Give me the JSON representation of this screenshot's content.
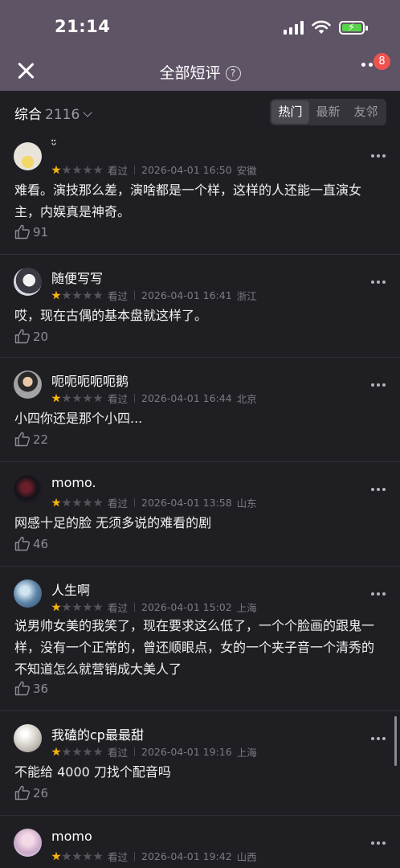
{
  "status_bar": {
    "time": "21:14"
  },
  "header": {
    "title": "全部短评",
    "help_icon": "?",
    "badge_count": "8"
  },
  "filter": {
    "sort_label": "综合",
    "count": "2116",
    "tabs": [
      {
        "label": "热门",
        "active": true
      },
      {
        "label": "最新",
        "active": false
      },
      {
        "label": "友邻",
        "active": false
      }
    ]
  },
  "reviews": [
    {
      "name": "ᵕ̈",
      "rating": 1,
      "status": "看过",
      "datetime": "2026-04-01 16:50",
      "location": "安徽",
      "text": "难看。演技那么差，演啥都是一个样，这样的人还能一直演女主，内娱真是神奇。",
      "likes": "91"
    },
    {
      "name": "随便写写",
      "rating": 1,
      "status": "看过",
      "datetime": "2026-04-01 16:41",
      "location": "浙江",
      "text": "哎，现在古偶的基本盘就这样了。",
      "likes": "20"
    },
    {
      "name": "呃呃呃呃呃鹅",
      "rating": 1,
      "status": "看过",
      "datetime": "2026-04-01 16:44",
      "location": "北京",
      "text": "小四你还是那个小四...",
      "likes": "22"
    },
    {
      "name": "momo.",
      "rating": 1,
      "status": "看过",
      "datetime": "2026-04-01 13:58",
      "location": "山东",
      "text": "网感十足的脸 无须多说的难看的剧",
      "likes": "46"
    },
    {
      "name": "人生啊",
      "rating": 1,
      "status": "看过",
      "datetime": "2026-04-01 15:02",
      "location": "上海",
      "text": "说男帅女美的我笑了，现在要求这么低了，一个个脸画的跟鬼一样，没有一个正常的，曾还顺眼点，女的一个夹子音一个清秀的不知道怎么就营销成大美人了",
      "likes": "36"
    },
    {
      "name": "我磕的cp最最甜",
      "rating": 1,
      "status": "看过",
      "datetime": "2026-04-01 19:16",
      "location": "上海",
      "text": "不能给 4000 刀找个配音吗",
      "likes": "26"
    },
    {
      "name": "momo",
      "rating": 1,
      "status": "看过",
      "datetime": "2026-04-01 19:42",
      "location": "山西",
      "text": "",
      "likes": ""
    }
  ]
}
